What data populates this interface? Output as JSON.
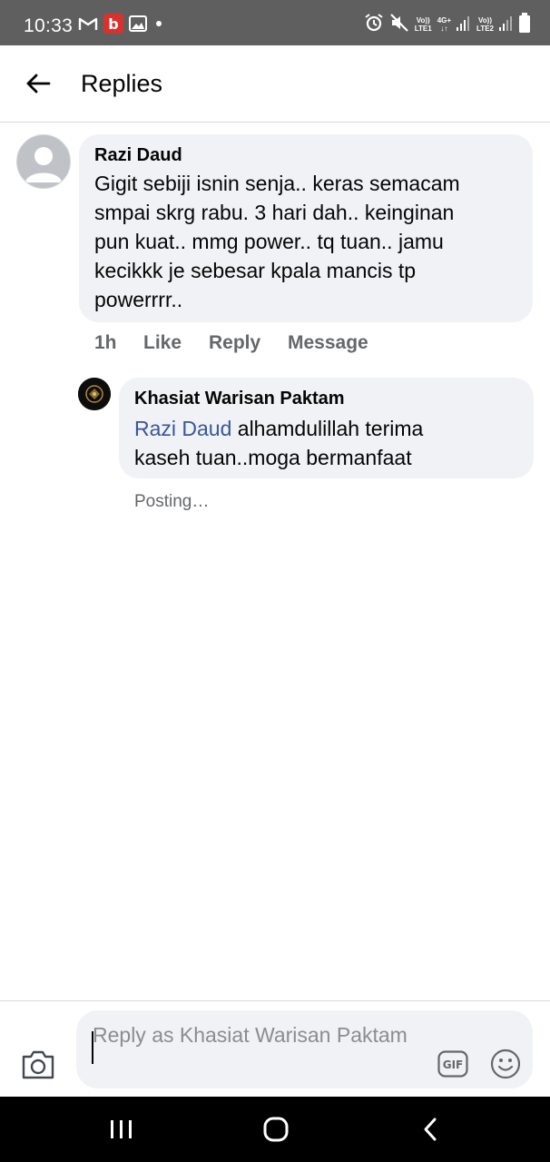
{
  "status_bar": {
    "time": "10:33",
    "icons_left": [
      "gmail-icon",
      "app-notification-icon",
      "gallery-icon",
      "dot-icon"
    ],
    "icons_right": [
      "alarm-icon",
      "mute-icon",
      "volte-lte1-icon",
      "signal-icon",
      "volte-lte2-icon",
      "signal-icon",
      "battery-icon"
    ],
    "volte1_top": "Vo))",
    "volte1_bottom": "LTE1",
    "net_label": "4G+",
    "volte2_top": "Vo))",
    "volte2_bottom": "LTE2"
  },
  "header": {
    "title": "Replies"
  },
  "comment": {
    "author": "Razi Daud",
    "text": "Gigit sebiji isnin senja.. keras semacam smpai skrg rabu. 3 hari dah.. keinginan pun kuat.. mmg power.. tq tuan.. jamu kecikkk je sebesar kpala mancis tp powerrrr..",
    "line1": "Gigit sebiji isnin senja.. keras semacam",
    "line2": "smpai skrg rabu. 3 hari dah.. keinginan",
    "line3": "pun kuat.. mmg power.. tq tuan.. jamu",
    "line4": "kecikkk je sebesar kpala mancis tp",
    "line5": "powerrrr..",
    "time": "1h",
    "like_label": "Like",
    "reply_label": "Reply",
    "message_label": "Message"
  },
  "reply": {
    "author": "Khasiat Warisan Paktam",
    "mention": "Razi Daud",
    "line1_rest": " alhamdulillah terima",
    "line2": "kaseh tuan..moga bermanfaat",
    "status": "Posting…"
  },
  "composer": {
    "placeholder": "Reply as Khasiat Warisan Paktam",
    "value": ""
  },
  "colors": {
    "bubble": "#f0f2f5",
    "mention": "#385898",
    "secondary_text": "#65676b",
    "status_bar": "#5f5f5f"
  }
}
